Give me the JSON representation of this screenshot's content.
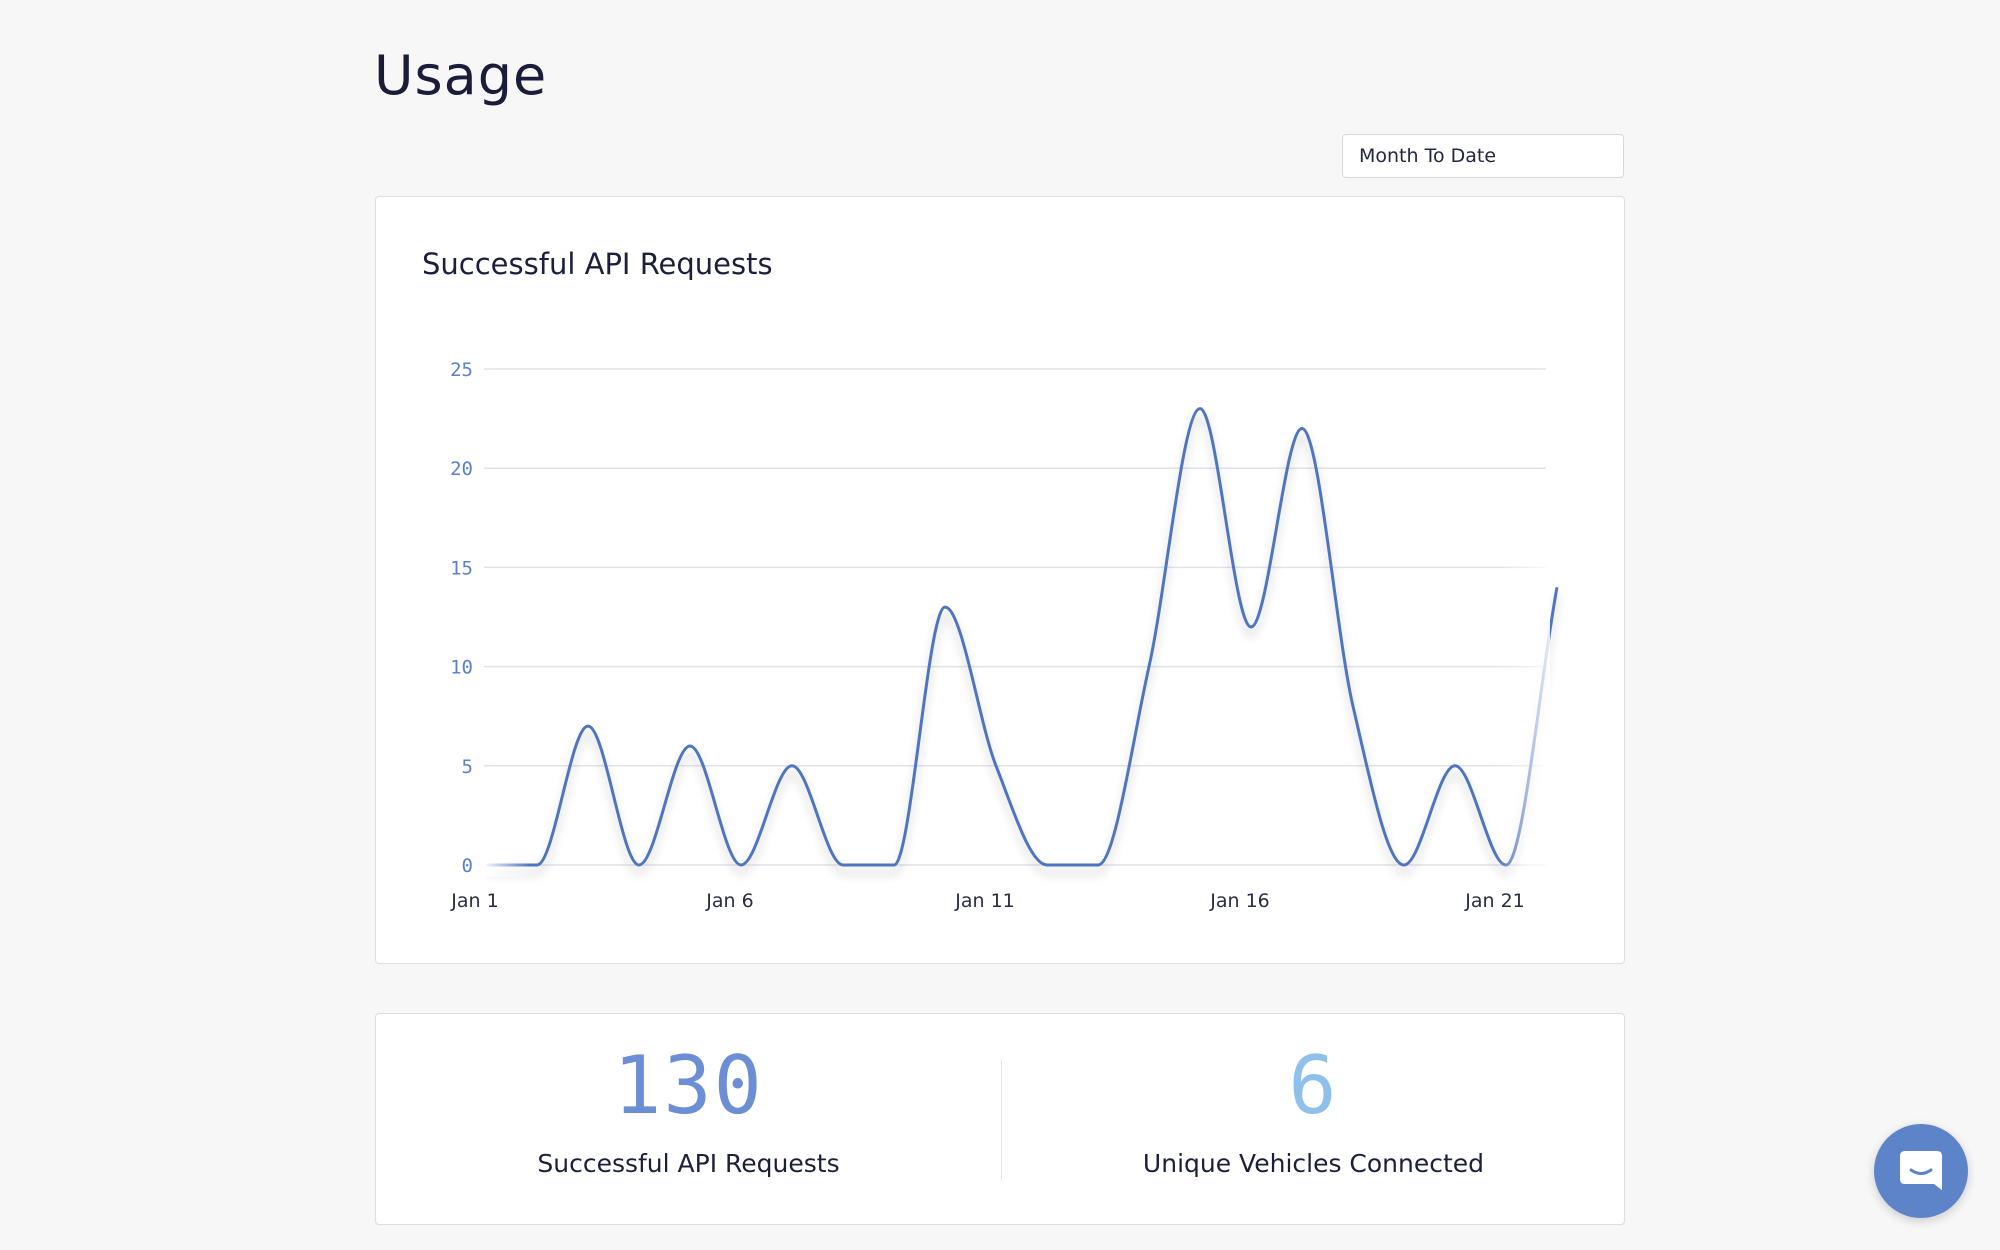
{
  "page": {
    "title": "Usage"
  },
  "filters": {
    "range_selected": "Month To Date"
  },
  "chart_card": {
    "title": "Successful API Requests"
  },
  "chart_data": {
    "type": "line",
    "title": "Successful API Requests",
    "xlabel": "",
    "ylabel": "",
    "x": [
      "Jan 1",
      "Jan 2",
      "Jan 3",
      "Jan 4",
      "Jan 5",
      "Jan 6",
      "Jan 7",
      "Jan 8",
      "Jan 9",
      "Jan 10",
      "Jan 11",
      "Jan 12",
      "Jan 13",
      "Jan 14",
      "Jan 15",
      "Jan 16",
      "Jan 17",
      "Jan 18",
      "Jan 19",
      "Jan 20",
      "Jan 21",
      "Jan 22"
    ],
    "series": [
      {
        "values": [
          0,
          0,
          7,
          0,
          6,
          0,
          5,
          0,
          0,
          13,
          5,
          0,
          0,
          10,
          23,
          12,
          22,
          8,
          0,
          5,
          0,
          14
        ]
      }
    ],
    "x_tick_labels": [
      "Jan  1",
      "Jan  6",
      "Jan  11",
      "Jan  16",
      "Jan  21"
    ],
    "x_tick_index": [
      0,
      5,
      10,
      15,
      20
    ],
    "y_ticks": [
      "0",
      "5",
      "10",
      "15",
      "20",
      "25"
    ],
    "ylim": [
      0,
      25
    ],
    "grid": true,
    "line_color": "#4f74c0"
  },
  "stats": {
    "requests_value": "130",
    "requests_label": "Successful API Requests",
    "requests_color": "#6b8ed4",
    "vehicles_value": "6",
    "vehicles_label": "Unique Vehicles Connected",
    "vehicles_color": "#8fc0ec"
  },
  "chat": {
    "icon": "chat-icon",
    "color": "#5d84c9"
  }
}
